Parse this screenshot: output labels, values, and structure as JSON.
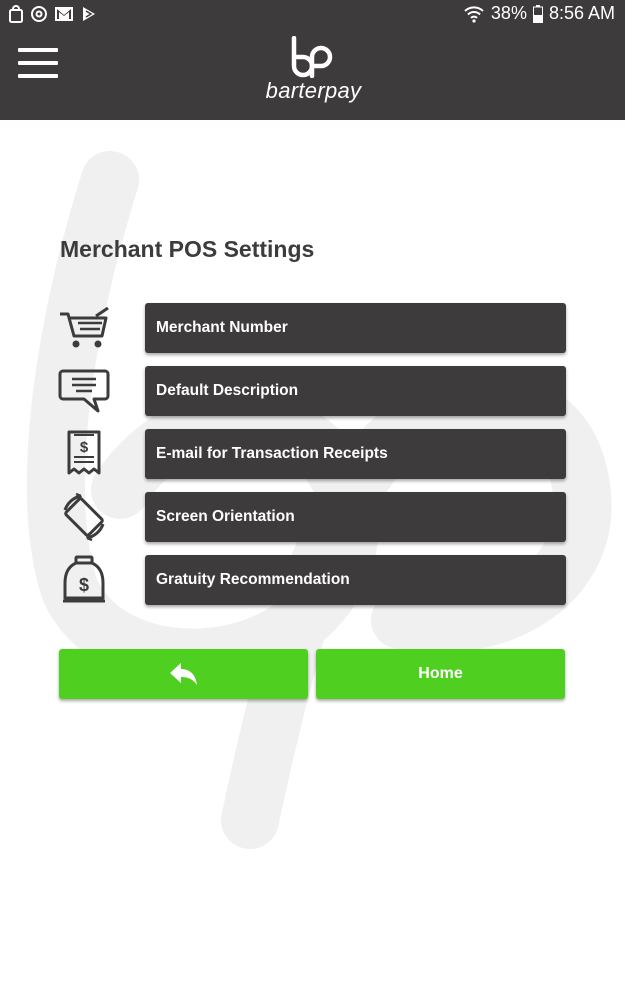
{
  "status_bar": {
    "battery": "38%",
    "time": "8:56 AM"
  },
  "app_bar": {
    "logo_text": "barterpay"
  },
  "page": {
    "title": "Merchant POS Settings"
  },
  "settings": [
    {
      "label": "Merchant Number",
      "icon": "shopping-cart-icon"
    },
    {
      "label": "Default Description",
      "icon": "chat-bubble-icon"
    },
    {
      "label": "E-mail for Transaction Receipts",
      "icon": "receipt-icon"
    },
    {
      "label": "Screen Orientation",
      "icon": "screen-rotation-icon"
    },
    {
      "label": "Gratuity Recommendation",
      "icon": "tip-jar-icon"
    }
  ],
  "actions": {
    "back_icon": "reply-arrow-icon",
    "home_label": "Home"
  },
  "colors": {
    "bar": "#3d3b3c",
    "button_dark": "#3d3b3c",
    "button_green": "#4fd020",
    "watermark": "#f0f0f0"
  }
}
